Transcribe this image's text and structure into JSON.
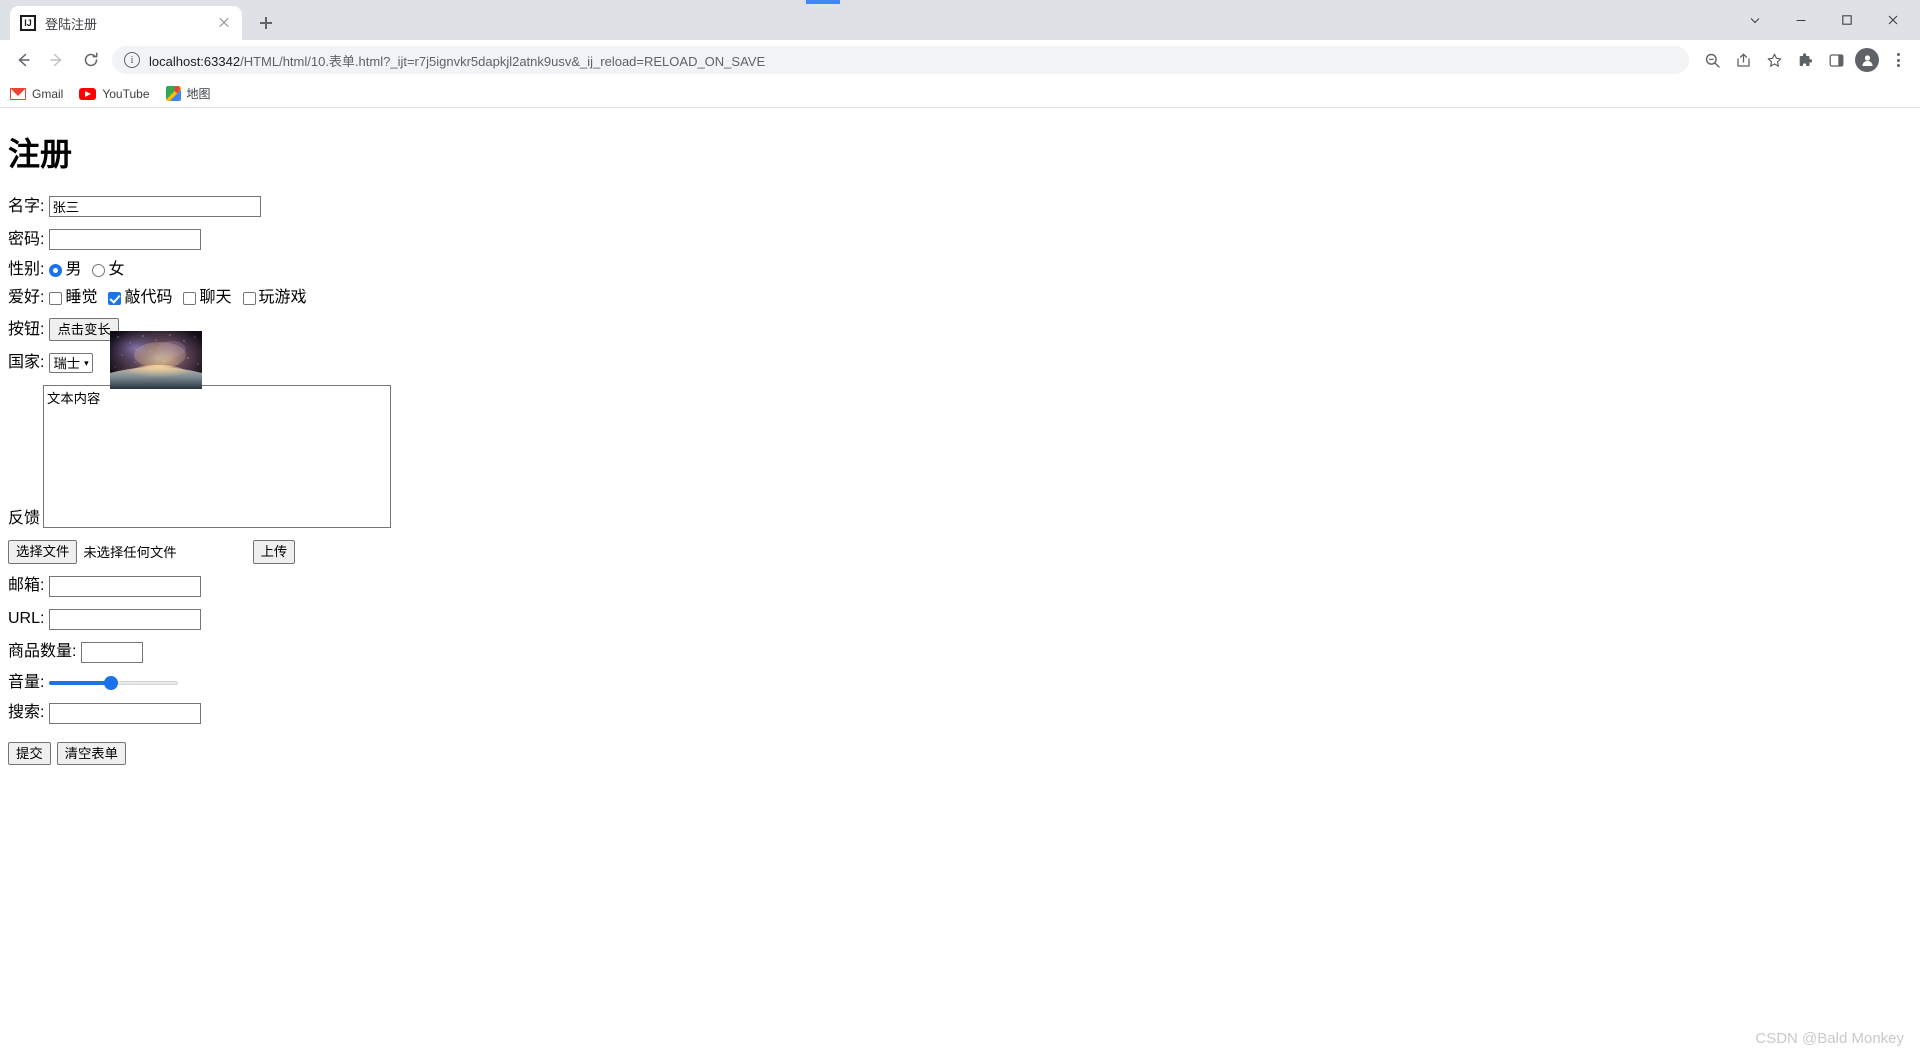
{
  "browser": {
    "tab": {
      "title": "登陆注册",
      "favicon": "IJ"
    },
    "newtab_label": "+",
    "window_controls": {
      "minimize": "—",
      "maximize": "□",
      "close": "✕",
      "chevron": "⌄"
    },
    "nav": {
      "back": "←",
      "forward": "→",
      "reload": "⟳"
    },
    "omnibox": {
      "host": "localhost:63342",
      "rest": "/HTML/html/10.表单.html?_ijt=r7j5ignvkr5dapkjl2atnk9usv&_ij_reload=RELOAD_ON_SAVE",
      "full": "localhost:63342/HTML/html/10.表单.html?_ijt=r7j5ignvkr5dapkjl2atnk9usv&_ij_reload=RELOAD_ON_SAVE"
    },
    "bookmarks": [
      {
        "label": "Gmail"
      },
      {
        "label": "YouTube"
      },
      {
        "label": "地图"
      }
    ]
  },
  "form": {
    "title": "注册",
    "name": {
      "label": "名字:",
      "value": "张三"
    },
    "password": {
      "label": "密码:",
      "value": ""
    },
    "gender": {
      "label": "性别:",
      "options": [
        {
          "label": "男",
          "checked": true
        },
        {
          "label": "女",
          "checked": false
        }
      ]
    },
    "hobby": {
      "label": "爱好:",
      "options": [
        {
          "label": "睡觉",
          "checked": false
        },
        {
          "label": "敲代码",
          "checked": true
        },
        {
          "label": "聊天",
          "checked": false
        },
        {
          "label": "玩游戏",
          "checked": false
        }
      ]
    },
    "button": {
      "label": "按钮:",
      "text": "点击变长"
    },
    "image": {
      "alt": "星空图片"
    },
    "country": {
      "label": "国家:",
      "value": "瑞士",
      "caret": "▾"
    },
    "feedback": {
      "label": "反馈",
      "value": "文本内容"
    },
    "file": {
      "choose_label": "选择文件",
      "status": "未选择任何文件",
      "upload_label": "上传"
    },
    "email": {
      "label": "邮箱:",
      "value": ""
    },
    "url": {
      "label": "URL:",
      "value": ""
    },
    "quantity": {
      "label": "商品数量:",
      "value": ""
    },
    "volume": {
      "label": "音量:",
      "value": "50"
    },
    "search": {
      "label": "搜索:",
      "value": ""
    },
    "actions": {
      "submit": "提交",
      "reset": "清空表单"
    }
  },
  "watermark": "CSDN @Bald Monkey",
  "colors": {
    "accent": "#1a73e8",
    "chrome_bg": "#dee1e6",
    "omnibox_bg": "#f1f3f4"
  }
}
